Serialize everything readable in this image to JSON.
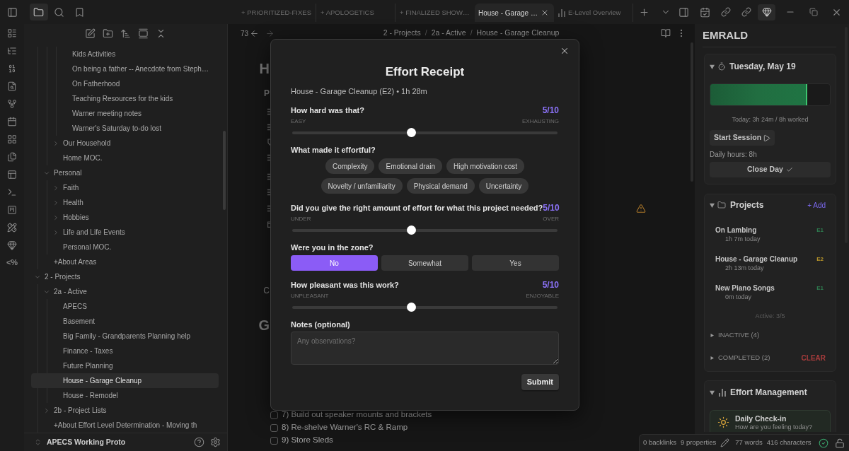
{
  "ribbon": {
    "templater_label": "<%"
  },
  "tabs": [
    {
      "label": "+ PRIORITIZED-FIXES",
      "selected": false,
      "kind": "note"
    },
    {
      "label": "+ APOLOGETICS",
      "selected": false,
      "kind": "note"
    },
    {
      "label": "+ FINALIZED SHOW…",
      "selected": false,
      "kind": "note"
    },
    {
      "label": "House - Garage …",
      "selected": true,
      "kind": "note"
    },
    {
      "label": "E-Level Overview",
      "selected": false,
      "kind": "chart"
    }
  ],
  "sidebar": {
    "tree": [
      {
        "children": [
          {
            "children": [
              {
                "children": [
                  {
                    "label": "Kids Activities",
                    "selected": false
                  },
                  {
                    "label": "On being a father -- Anecdote from Steph…",
                    "selected": false
                  },
                  {
                    "label": "On Fatherhood",
                    "selected": false
                  },
                  {
                    "label": "Teaching Resources for the kids",
                    "selected": false
                  },
                  {
                    "label": "Warner meeting notes",
                    "selected": false
                  },
                  {
                    "label": "Warner's Saturday to-do lost",
                    "selected": false
                  }
                ]
              },
              {
                "label": "Our Household",
                "expanded": false,
                "selected": false
              },
              {
                "label": "Home MOC.",
                "selected": false
              }
            ]
          },
          {
            "label": "Personal",
            "expanded": true,
            "selected": false,
            "children": [
              {
                "label": "Faith",
                "expanded": false,
                "selected": false
              },
              {
                "label": "Health",
                "expanded": false,
                "selected": false
              },
              {
                "label": "Hobbies",
                "expanded": false,
                "selected": false
              },
              {
                "label": "Life and Life Events",
                "expanded": false,
                "selected": false
              },
              {
                "label": "Personal MOC.",
                "selected": false
              }
            ]
          },
          {
            "label": "+About Areas",
            "selected": false
          }
        ]
      },
      {
        "label": "2 - Projects",
        "expanded": true,
        "selected": false,
        "children": [
          {
            "label": "2a - Active",
            "expanded": true,
            "selected": false,
            "children": [
              {
                "label": "APECS",
                "selected": false
              },
              {
                "label": "Basement",
                "selected": false
              },
              {
                "label": "Big Family - Grandparents Planning help",
                "selected": false
              },
              {
                "label": "Finance - Taxes",
                "selected": false
              },
              {
                "label": "Future Planning",
                "selected": false
              },
              {
                "label": "House - Garage Cleanup",
                "selected": true
              },
              {
                "label": "House - Remodel",
                "selected": false
              }
            ]
          },
          {
            "label": "2b - Project Lists",
            "expanded": false,
            "selected": false
          },
          {
            "label": "+About Effort Level Determination - Moving th",
            "selected": false
          }
        ]
      }
    ],
    "vault_name": "APECS Working Proto"
  },
  "editor": {
    "nav_count": "73",
    "breadcrumb": [
      "2 - Projects",
      "2a - Active",
      "House - Garage Cleanup"
    ],
    "breadcrumb_separator": "/",
    "fragments": [
      {
        "kind": "heading",
        "text": "H"
      },
      {
        "kind": "label",
        "text": "P"
      },
      {
        "kind": "text",
        "text": "C"
      },
      {
        "kind": "heading",
        "text": "G"
      }
    ],
    "tasks": [
      {
        "label": "7) Build out speaker mounts and brackets",
        "checked": false
      },
      {
        "label": "8) Re-shelve Warner's RC & Ramp",
        "checked": false
      },
      {
        "label": "9) Store Sleds",
        "checked": false
      }
    ]
  },
  "dialog": {
    "title": "Effort Receipt",
    "subtitle": "House - Garage Cleanup (E2) • 1h 28m",
    "questions": [
      {
        "kind": "slider",
        "label": "How hard was that?",
        "value": "5/10",
        "min_label": "EASY",
        "max_label": "EXHAUSTING",
        "level": 0.45
      },
      {
        "kind": "chips",
        "label": "What made it effortful?",
        "options": [
          {
            "label": "Complexity",
            "selected": false
          },
          {
            "label": "Emotional drain",
            "selected": false
          },
          {
            "label": "High motivation cost",
            "selected": false
          },
          {
            "label": "Novelty / unfamiliarity",
            "selected": false
          },
          {
            "label": "Physical demand",
            "selected": false
          },
          {
            "label": "Uncertainty",
            "selected": false
          }
        ]
      },
      {
        "kind": "slider",
        "label": "Did you give the right amount of effort for what this project needed?",
        "value": "5/10",
        "min_label": "UNDER",
        "max_label": "OVER",
        "level": 0.45
      },
      {
        "kind": "choice",
        "label": "Were you in the zone?",
        "options": [
          {
            "label": "No",
            "selected": true
          },
          {
            "label": "Somewhat",
            "selected": false
          },
          {
            "label": "Yes",
            "selected": false
          }
        ]
      },
      {
        "kind": "slider",
        "label": "How pleasant was this work?",
        "value": "5/10",
        "min_label": "UNPLEASANT",
        "max_label": "ENJOYABLE",
        "level": 0.45
      },
      {
        "kind": "notes",
        "label": "Notes (optional)",
        "placeholder": "Any observations?"
      }
    ],
    "submit": "Submit"
  },
  "right_panel": {
    "title": "EMRALD",
    "day": {
      "title": "Tuesday, May 19",
      "expanded": true,
      "level": 0.81,
      "summary": "Today: 3h 24m / 8h worked",
      "start_button": "Start Session",
      "daily_hours": "Daily hours: 8h",
      "close_button": "Close Day"
    },
    "projects": {
      "title": "Projects",
      "expanded": true,
      "add_label": "+ Add",
      "items": [
        {
          "name": "On Lambing",
          "time": "1h 7m today",
          "effort": "E1",
          "color": "#2e7d50"
        },
        {
          "name": "House - Garage Cleanup",
          "time": "2h 13m today",
          "effort": "E2",
          "color": "#b8952a"
        },
        {
          "name": "New Piano Songs",
          "time": "0m today",
          "effort": "E1",
          "color": "#2e7d50"
        }
      ],
      "active_count": "Active: 3/5",
      "sections": [
        {
          "label": "INACTIVE (4)",
          "expanded": false
        },
        {
          "label": "COMPLETED (2)",
          "expanded": false,
          "action": "CLEAR"
        }
      ]
    },
    "effort": {
      "title": "Effort Management",
      "expanded": true,
      "check_in": {
        "title": "Daily Check-in",
        "subtitle": "How are you feeling today?"
      }
    }
  },
  "status_bar": {
    "backlinks": "0 backlinks",
    "properties": "9 properties",
    "words": "77 words",
    "characters": "416 characters"
  }
}
